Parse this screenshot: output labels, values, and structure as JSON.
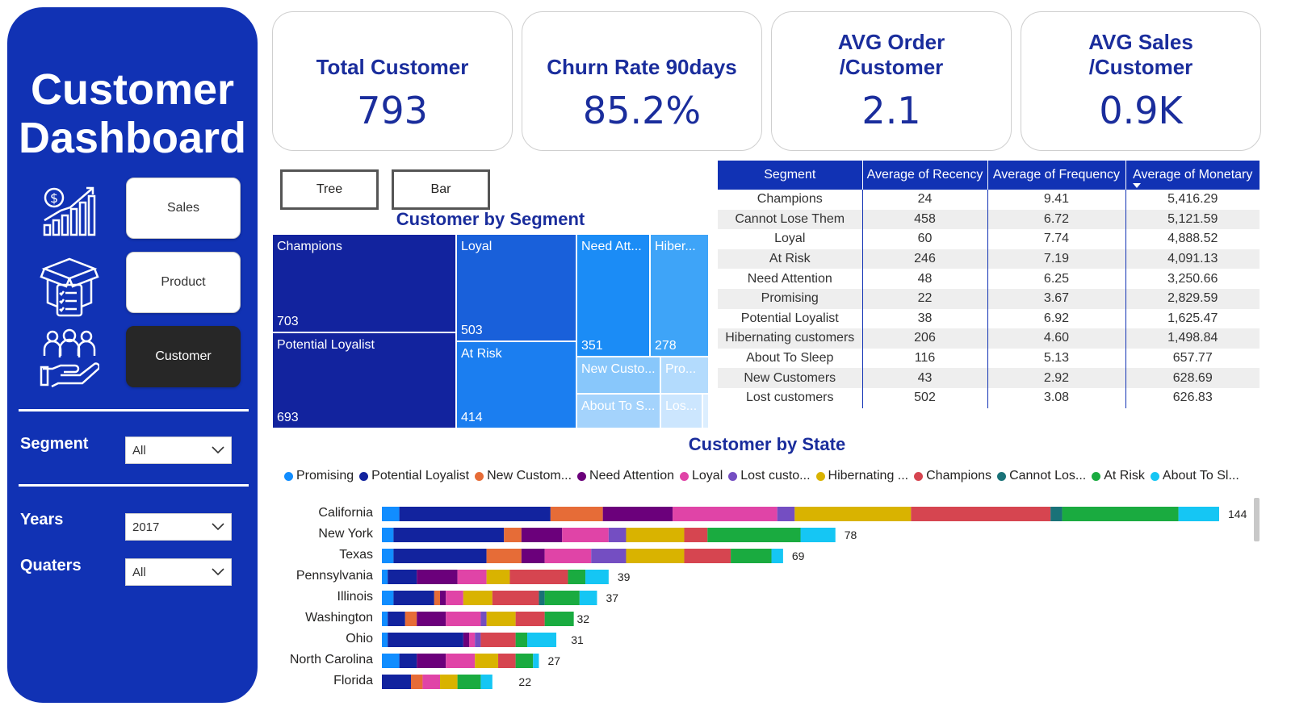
{
  "sidebar": {
    "title": "Customer Dashboard",
    "nav": [
      {
        "label": "Sales",
        "icon": "sales-growth-icon",
        "active": false
      },
      {
        "label": "Product",
        "icon": "product-box-icon",
        "active": false
      },
      {
        "label": "Customer",
        "icon": "customer-group-icon",
        "active": true
      }
    ],
    "filters": [
      {
        "label": "Segment",
        "value": "All"
      },
      {
        "label": "Years",
        "value": "2017"
      },
      {
        "label": "Quaters",
        "value": "All"
      }
    ]
  },
  "kpis": [
    {
      "label": "Total Customer",
      "value": "793"
    },
    {
      "label": "Churn Rate 90days",
      "value": "85.2%"
    },
    {
      "label": "AVG Order\n/Customer",
      "value": "2.1"
    },
    {
      "label": "AVG Sales\n/Customer",
      "value": "0.9K"
    }
  ],
  "toggles": {
    "tree": "Tree",
    "bar": "Bar"
  },
  "treemap": {
    "title": "Customer by Segment",
    "tiles": [
      {
        "label": "Champions",
        "value": "703"
      },
      {
        "label": "Potential Loyalist",
        "value": "693"
      },
      {
        "label": "Loyal",
        "value": "503"
      },
      {
        "label": "At Risk",
        "value": "414"
      },
      {
        "label": "Need Att...",
        "value": "351"
      },
      {
        "label": "Hiber...",
        "value": "278"
      },
      {
        "label": "New Custo...",
        "value": ""
      },
      {
        "label": "Pro...",
        "value": ""
      },
      {
        "label": "About To S...",
        "value": ""
      },
      {
        "label": "Los...",
        "value": ""
      }
    ]
  },
  "table": {
    "columns": [
      "Segment",
      "Average of Recency",
      "Average of Frequency",
      "Average of Monetary"
    ],
    "rows": [
      [
        "Champions",
        "24",
        "9.41",
        "5,416.29"
      ],
      [
        "Cannot Lose Them",
        "458",
        "6.72",
        "5,121.59"
      ],
      [
        "Loyal",
        "60",
        "7.74",
        "4,888.52"
      ],
      [
        "At Risk",
        "246",
        "7.19",
        "4,091.13"
      ],
      [
        "Need Attention",
        "48",
        "6.25",
        "3,250.66"
      ],
      [
        "Promising",
        "22",
        "3.67",
        "2,829.59"
      ],
      [
        "Potential Loyalist",
        "38",
        "6.92",
        "1,625.47"
      ],
      [
        "Hibernating customers",
        "206",
        "4.60",
        "1,498.84"
      ],
      [
        "About To Sleep",
        "116",
        "5.13",
        "657.77"
      ],
      [
        "New Customers",
        "43",
        "2.92",
        "628.69"
      ],
      [
        "Lost customers",
        "502",
        "3.08",
        "626.83"
      ]
    ]
  },
  "chart_data": {
    "type": "bar",
    "orientation": "horizontal",
    "stacked": true,
    "title": "Customer by State",
    "legend_position": "top",
    "categories": [
      "California",
      "New York",
      "Texas",
      "Pennsylvania",
      "Illinois",
      "Washington",
      "Ohio",
      "North Carolina",
      "Florida"
    ],
    "totals": [
      144,
      78,
      69,
      39,
      37,
      32,
      31,
      27,
      22
    ],
    "series": [
      {
        "name": "Promising",
        "legend": "Promising",
        "color": "#118dff",
        "values": [
          3,
          2,
          2,
          1,
          2,
          1,
          1,
          3,
          0
        ]
      },
      {
        "name": "Potential Loyalist",
        "legend": "Potential Loyalist",
        "color": "#12239e",
        "values": [
          26,
          19,
          16,
          5,
          7,
          3,
          13,
          3,
          5
        ]
      },
      {
        "name": "New Customers",
        "legend": "New Custom...",
        "color": "#e66c37",
        "values": [
          9,
          3,
          6,
          0,
          1,
          2,
          0,
          0,
          2
        ]
      },
      {
        "name": "Need Attention",
        "legend": "Need Attention",
        "color": "#6b007b",
        "values": [
          12,
          7,
          4,
          7,
          1,
          5,
          1,
          5,
          0
        ]
      },
      {
        "name": "Loyal",
        "legend": "Loyal",
        "color": "#e044a7",
        "values": [
          18,
          8,
          8,
          5,
          3,
          6,
          1,
          5,
          3
        ]
      },
      {
        "name": "Lost customers",
        "legend": "Lost custo...",
        "color": "#744ec2",
        "values": [
          3,
          3,
          6,
          0,
          0,
          1,
          1,
          0,
          0
        ]
      },
      {
        "name": "Hibernating customers",
        "legend": "Hibernating ...",
        "color": "#d9b300",
        "values": [
          20,
          10,
          10,
          4,
          5,
          5,
          0,
          4,
          3
        ]
      },
      {
        "name": "Champions",
        "legend": "Champions",
        "color": "#d64550",
        "values": [
          24,
          4,
          8,
          10,
          8,
          5,
          6,
          3,
          0
        ]
      },
      {
        "name": "Cannot Lose Them",
        "legend": "Cannot Los...",
        "color": "#197278",
        "values": [
          2,
          0,
          0,
          0,
          1,
          0,
          0,
          0,
          0
        ]
      },
      {
        "name": "At Risk",
        "legend": "At Risk",
        "color": "#1aab40",
        "values": [
          20,
          16,
          7,
          3,
          6,
          5,
          2,
          3,
          4
        ]
      },
      {
        "name": "About To Sleep",
        "legend": "About To Sl...",
        "color": "#15c6f4",
        "values": [
          7,
          6,
          2,
          4,
          3,
          0,
          5,
          1,
          2
        ]
      }
    ]
  }
}
